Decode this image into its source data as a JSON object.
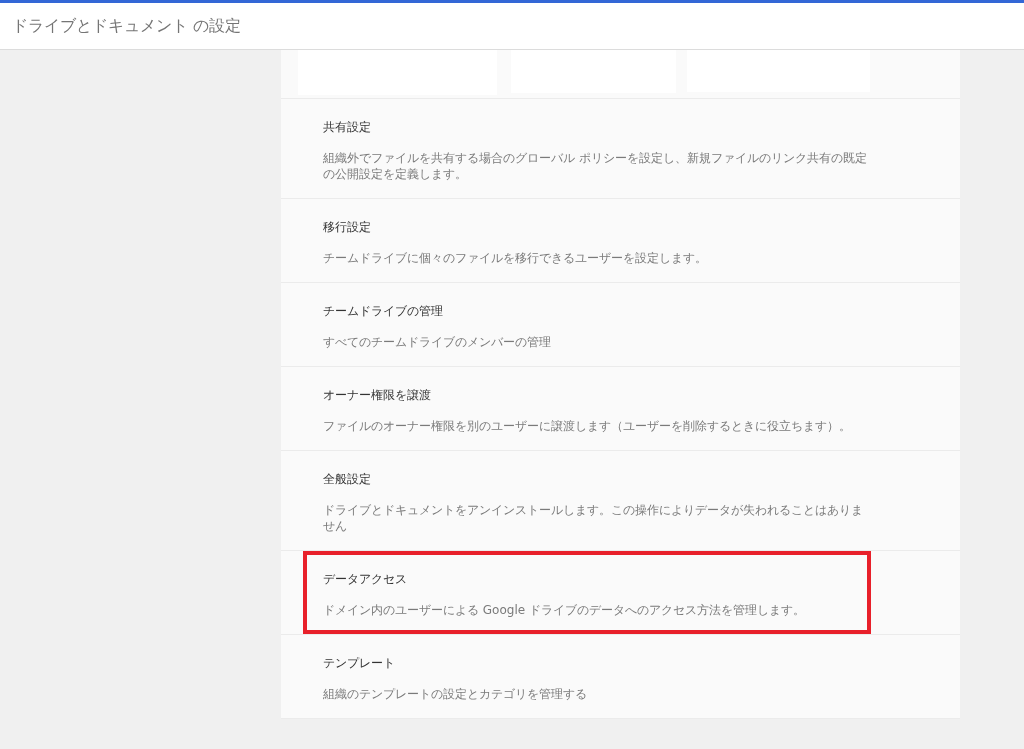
{
  "header": {
    "title": "ドライブとドキュメント の設定"
  },
  "settings": [
    {
      "title": "共有設定",
      "description": "組織外でファイルを共有する場合のグローバル ポリシーを設定し、新規ファイルのリンク共有の既定の公開設定を定義します。",
      "highlighted": false
    },
    {
      "title": "移行設定",
      "description": "チームドライブに個々のファイルを移行できるユーザーを設定します。",
      "highlighted": false
    },
    {
      "title": "チームドライブの管理",
      "description": "すべてのチームドライブのメンバーの管理",
      "highlighted": false
    },
    {
      "title": "オーナー権限を譲渡",
      "description": "ファイルのオーナー権限を別のユーザーに譲渡します（ユーザーを削除するときに役立ちます）。",
      "highlighted": false
    },
    {
      "title": "全般設定",
      "description": "ドライブとドキュメントをアンインストールします。この操作によりデータが失われることはありません",
      "highlighted": false
    },
    {
      "title": "データアクセス",
      "description": "ドメイン内のユーザーによる Google ドライブのデータへのアクセス方法を管理します。",
      "highlighted": true
    },
    {
      "title": "テンプレート",
      "description": "組織のテンプレートの設定とカテゴリを管理する",
      "highlighted": false
    }
  ]
}
